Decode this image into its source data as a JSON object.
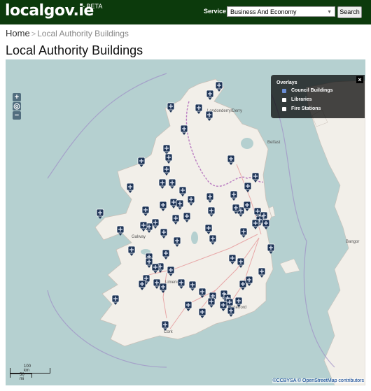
{
  "header": {
    "logo": "localgov.ie",
    "beta": "- BETA",
    "service_label": "Service",
    "service_value": "Business And Economy",
    "search_label": "Search"
  },
  "breadcrumb": {
    "home": "Home",
    "current": "Local Authority Buildings"
  },
  "page_title": "Local Authority Buildings",
  "map": {
    "zoom_in": "+",
    "zoom_out": "−",
    "overlays": {
      "title": "Overlays",
      "close": "×",
      "items": [
        {
          "label": "Council Buildings",
          "checked": true
        },
        {
          "label": "Libraries",
          "checked": false
        },
        {
          "label": "Fire Stations",
          "checked": false
        }
      ]
    },
    "scale_km": "100 km",
    "scale_mi": "50 mi",
    "attribution": "©CCBYSA © OpenStreetMap contributors",
    "place_labels": [
      "Londonderry/Derry",
      "Belfast",
      "Galway",
      "Bangor",
      "Cork",
      "Limerick",
      "Waterford"
    ],
    "colors": {
      "sea": "#b5d0d0",
      "land": "#f2efe9",
      "topbar": "#0c3a0c",
      "marker": "#1f3557"
    }
  }
}
